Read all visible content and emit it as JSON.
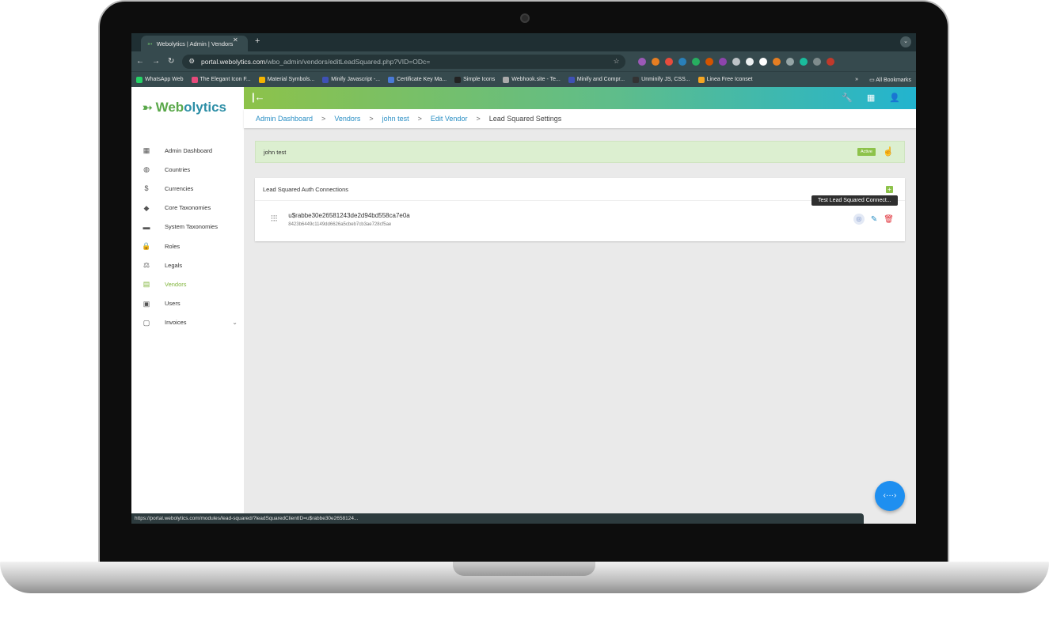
{
  "browser": {
    "tab_title": "Webolytics | Admin | Vendors",
    "tab_close": "✕",
    "new_tab": "+",
    "url_host": "portal.webolytics.com",
    "url_path": "/wbo_admin/vendors/editLeadSquared.php?VID=ODc=",
    "bookmarks": [
      {
        "label": "WhatsApp Web",
        "color": "#25d366"
      },
      {
        "label": "The Elegant Icon F...",
        "color": "#e64a7b"
      },
      {
        "label": "Material Symbols...",
        "color": "#f4b400"
      },
      {
        "label": "Minify Javascript -...",
        "color": "#3f51b5"
      },
      {
        "label": "Certificate Key Ma...",
        "color": "#4a7ad6"
      },
      {
        "label": "Simple Icons",
        "color": "#222222"
      },
      {
        "label": "Webhook.site - Te...",
        "color": "#aaaaaa"
      },
      {
        "label": "Minify and Compr...",
        "color": "#3f51b5"
      },
      {
        "label": "Unminify JS, CSS...",
        "color": "#333333"
      },
      {
        "label": "Linea Free Iconset",
        "color": "#f5a623"
      }
    ],
    "more_bookmarks": "»",
    "all_bookmarks": "All Bookmarks",
    "status_url": "https://portal.webolytics.com/modules/lead-squared/?leadSquaredClientID=u$rabbe30e2658124..."
  },
  "brand": {
    "mark": "➳",
    "prefix": "Web",
    "suffix": "olytics"
  },
  "sidebar": {
    "items": [
      {
        "label": "Admin Dashboard",
        "icon": "▦"
      },
      {
        "label": "Countries",
        "icon": "◍"
      },
      {
        "label": "Currencies",
        "icon": "$"
      },
      {
        "label": "Core Taxonomies",
        "icon": "◆"
      },
      {
        "label": "System Taxonomies",
        "icon": "▬"
      },
      {
        "label": "Roles",
        "icon": "🔒"
      },
      {
        "label": "Legals",
        "icon": "⚖"
      },
      {
        "label": "Vendors",
        "icon": "▤"
      },
      {
        "label": "Users",
        "icon": "▣"
      },
      {
        "label": "Invoices",
        "icon": "▢",
        "chevron": "⌄"
      }
    ]
  },
  "breadcrumb": {
    "items": [
      "Admin Dashboard",
      "Vendors",
      "john test",
      "Edit Vendor"
    ],
    "current": "Lead Squared Settings",
    "separator": ">"
  },
  "vendor": {
    "name": "john test",
    "status": "Active"
  },
  "connections": {
    "title": "Lead Squared Auth Connections",
    "add_label": "+",
    "items": [
      {
        "client_id": "u$rabbe30e26581243de2d94bd558ca7e0a",
        "secret": "8423b6449c1149dd6626a5cbeb7cb3ae728cf5ae"
      }
    ],
    "tooltip": "Test Lead Squared Connect..."
  },
  "colors": {
    "accent_green": "#8dc24a",
    "accent_blue": "#2a8fc4",
    "danger": "#e0333b"
  }
}
